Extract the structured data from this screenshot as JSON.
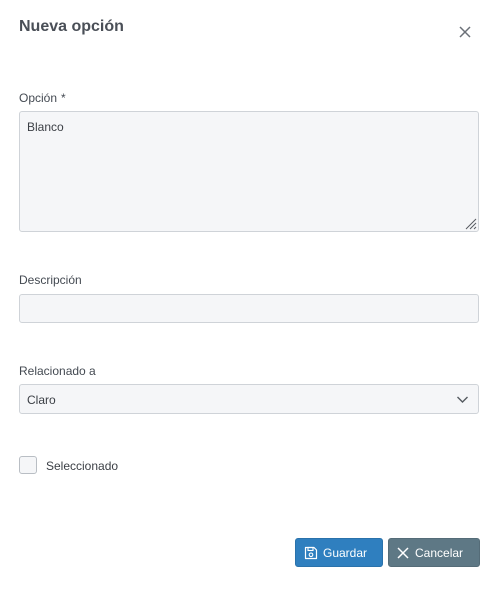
{
  "dialog": {
    "title": "Nueva opción",
    "close_icon": "close-icon"
  },
  "fields": {
    "option": {
      "label": "Opción",
      "required_marker": "*",
      "value": "Blanco"
    },
    "description": {
      "label": "Descripción",
      "value": ""
    },
    "related": {
      "label": "Relacionado a",
      "selected": "Claro",
      "icon": "chevron-down-icon"
    },
    "selected": {
      "label": "Seleccionado",
      "checked": false
    }
  },
  "buttons": {
    "save_label": "Guardar",
    "save_icon": "save-icon",
    "cancel_label": "Cancelar",
    "cancel_icon": "close-icon"
  },
  "colors": {
    "save_button": "#2f7fbf",
    "cancel_button": "#5e7885",
    "field_background": "#f5f6f8",
    "field_border": "#cfd3d8"
  }
}
